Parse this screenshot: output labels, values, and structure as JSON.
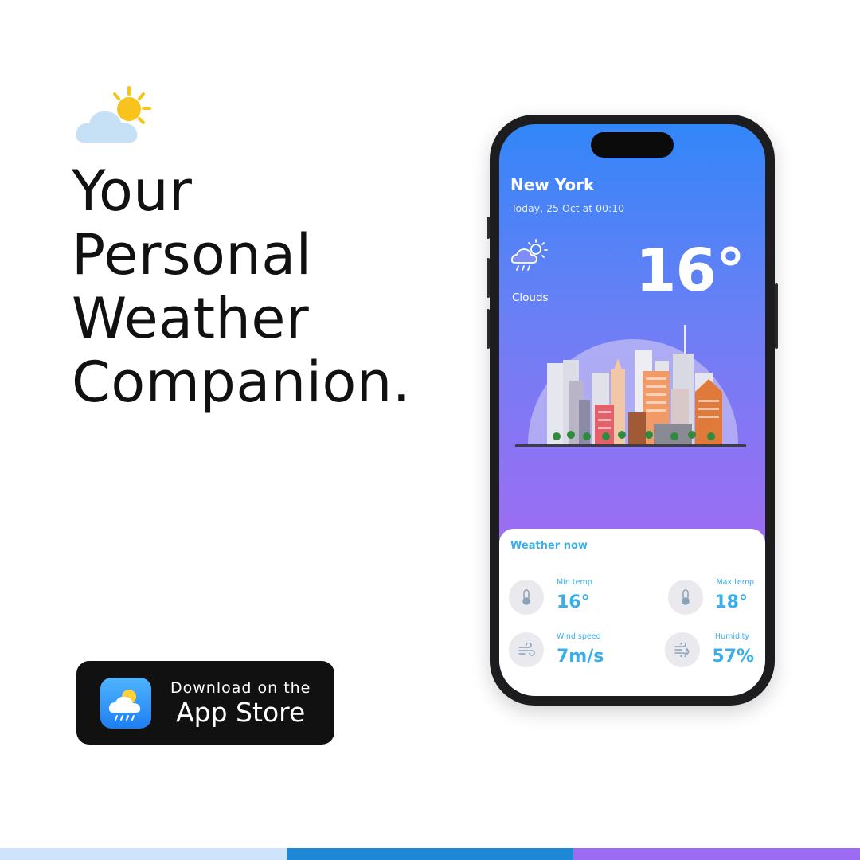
{
  "headline": {
    "lines": [
      "Your",
      "Personal",
      "Weather",
      "Companion."
    ]
  },
  "store_badge": {
    "small_text": "Download on the",
    "big_text": "App Store",
    "icon": "app-weather-icon"
  },
  "phone": {
    "city": "New York",
    "date": "Today, 25 Oct at 00:10",
    "condition": "Clouds",
    "condition_icon": "cloud-sun-rain-icon",
    "temperature": "16°",
    "card": {
      "title": "Weather now",
      "stats": [
        {
          "label": "Min temp",
          "value": "16°",
          "icon": "thermometer-icon"
        },
        {
          "label": "Max temp",
          "value": "18°",
          "icon": "thermometer-icon"
        },
        {
          "label": "Wind speed",
          "value": "7m/s",
          "icon": "wind-icon"
        },
        {
          "label": "Humidity",
          "value": "57%",
          "icon": "humidity-icon"
        }
      ]
    }
  },
  "colors": {
    "accent_blue": "#3aaeea",
    "gradient_top": "#3286f9",
    "gradient_bottom": "#a071f2",
    "stripe": [
      "#cfe4fb",
      "#1e88d6",
      "#9b6cf3"
    ]
  }
}
